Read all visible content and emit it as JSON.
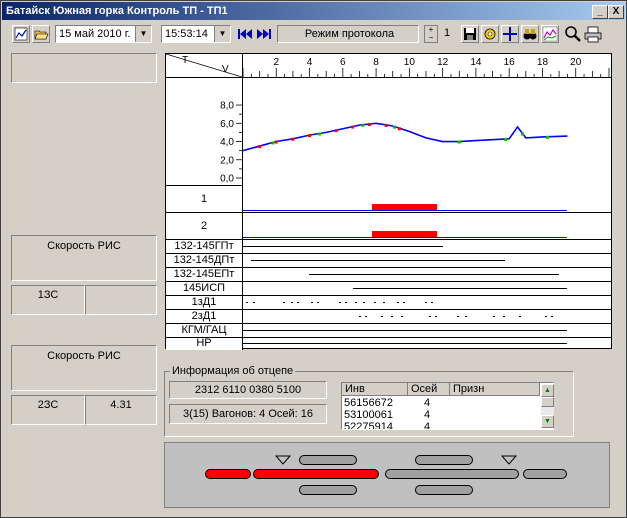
{
  "window": {
    "title": "Батайск Южная горка Контроль ТП - ТП1",
    "minimize": "_",
    "close": "X"
  },
  "toolbar": {
    "date_value": "15 май 2010 г.",
    "time_value": "15:53:14",
    "mode_label": "Режим протокола",
    "counter_value": "1",
    "icons": [
      "chart-icon",
      "open-folder-icon",
      "first-icon",
      "last-icon",
      "save-icon",
      "settings-icon",
      "cross-icon",
      "binoculars-icon",
      "graph-icon",
      "search-icon",
      "print-icon"
    ]
  },
  "left_panel": {
    "speed1_label": "Скорость РИС",
    "speed1_cell_left": "1ЗС",
    "speed1_cell_right": "",
    "speed2_label": "Скорость РИС",
    "speed2_cell_left": "2ЗС",
    "speed2_cell_right": "4.31"
  },
  "chart": {
    "corner_t": "T",
    "corner_v": "V",
    "x_ticks": [
      "2",
      "4",
      "6",
      "8",
      "10",
      "12",
      "14",
      "16",
      "18",
      "20"
    ],
    "y_ticks": [
      "8,0",
      "6,0",
      "4,0",
      "2,0",
      "0,0"
    ],
    "track_labels": [
      "1",
      "2",
      "132-145ГПт",
      "132-145ДПт",
      "132-145ЕПт",
      "145ИСП",
      "1зД1",
      "2зД1",
      "КГМ/ГАЦ",
      "НР"
    ]
  },
  "chart_data": {
    "type": "line",
    "title": "",
    "xlabel": "",
    "ylabel": "",
    "xlim": [
      0,
      22
    ],
    "ylim": [
      0,
      10
    ],
    "series": [
      {
        "x": [
          0,
          1,
          2,
          3,
          4,
          5,
          6,
          7,
          8,
          9,
          10,
          11,
          12,
          13,
          14,
          15,
          16,
          16.5,
          17,
          18,
          19.5
        ],
        "values": [
          3.0,
          3.5,
          4.0,
          4.3,
          4.7,
          5.0,
          5.4,
          5.8,
          6.0,
          5.7,
          5.1,
          4.4,
          4.0,
          4.0,
          4.1,
          4.2,
          4.3,
          5.6,
          4.4,
          4.5,
          4.6
        ]
      }
    ],
    "markers": [
      {
        "color": "#ff0000",
        "x": [
          1,
          2,
          3,
          4,
          5.6,
          6.6,
          7.6,
          8.6,
          9.4
        ]
      },
      {
        "color": "#00c000",
        "x": [
          1.8,
          4.6,
          7.2,
          9.1,
          13,
          15.8,
          16.8,
          18.3
        ]
      }
    ]
  },
  "info": {
    "group_title": "Информация об отцепе",
    "code": "2312 6110 0380 5100",
    "summary": "3(15) Вагонов: 4  Осей: 16",
    "table_headers": [
      "Инв",
      "Осей",
      "Призн"
    ],
    "rows": [
      {
        "inv": "56156672",
        "axles": "4",
        "sign": ""
      },
      {
        "inv": "53100061",
        "axles": "4",
        "sign": ""
      },
      {
        "inv": "52275914",
        "axles": "4",
        "sign": ""
      }
    ]
  },
  "colors": {
    "occupied": "#ff0000",
    "free": "#a0a0a0",
    "curve": "#0000ff",
    "title_start": "#0a246a"
  }
}
